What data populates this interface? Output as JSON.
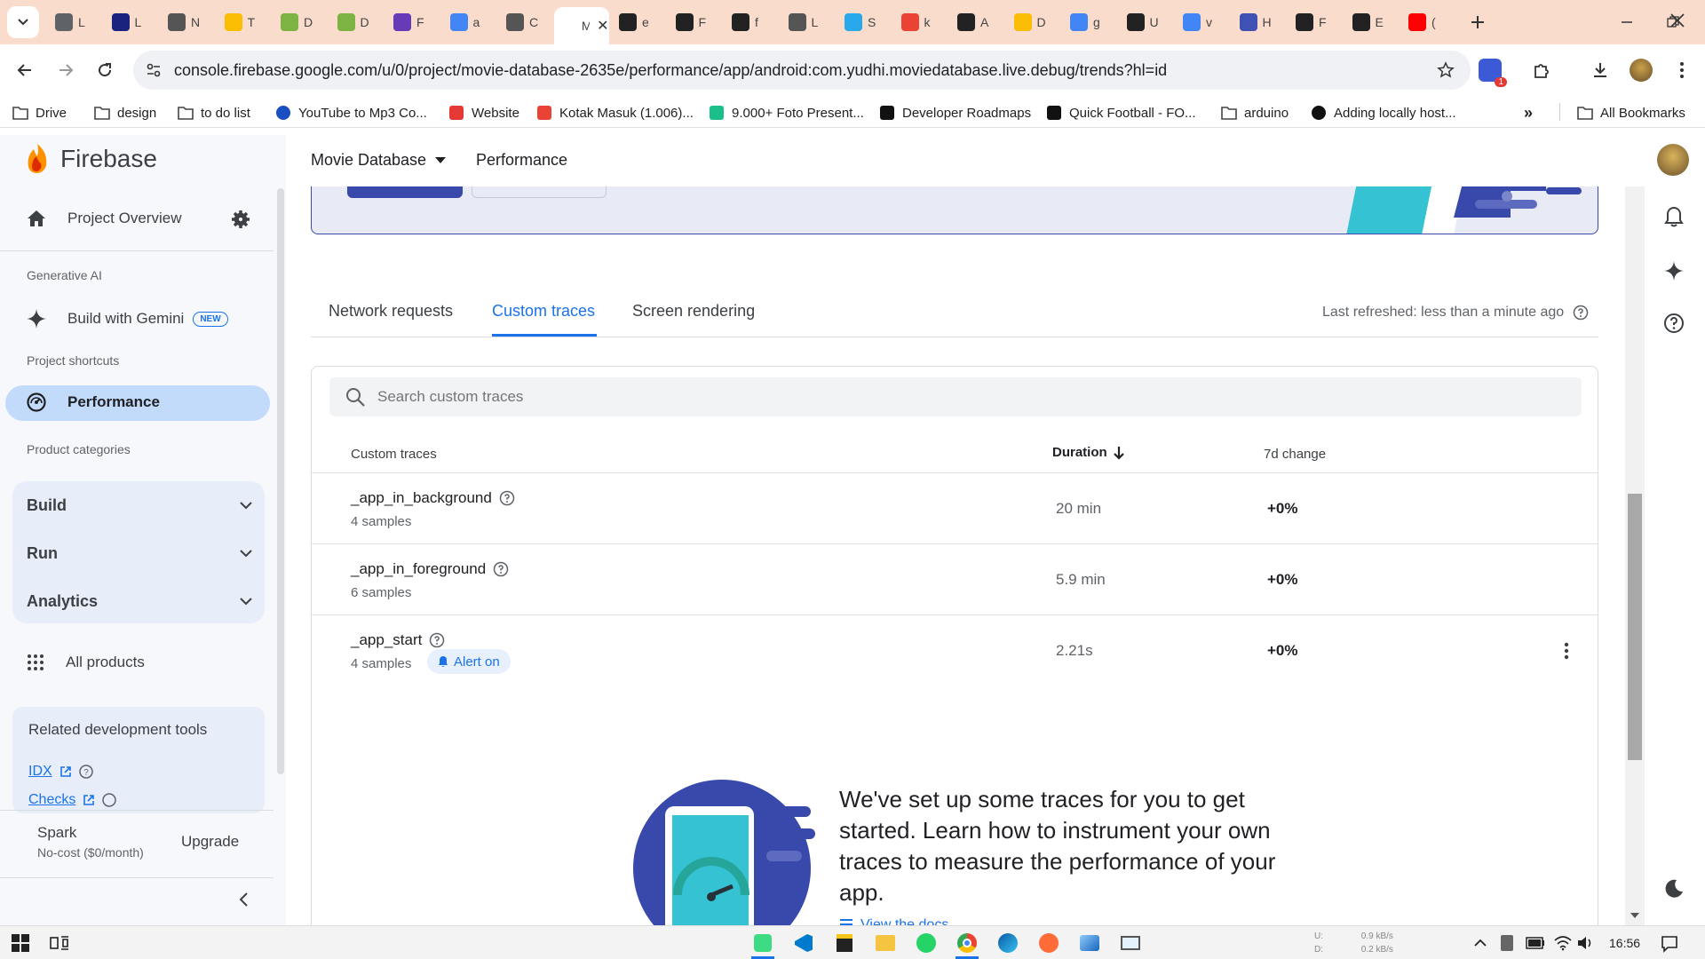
{
  "browser": {
    "tabs": [
      {
        "title": "L",
        "color": "#5f6368"
      },
      {
        "title": "L",
        "color": "#1a237e"
      },
      {
        "title": "N",
        "color": "#555"
      },
      {
        "title": "T",
        "color": "#fbbc04"
      },
      {
        "title": "D",
        "color": "#7cb342"
      },
      {
        "title": "D",
        "color": "#7cb342"
      },
      {
        "title": "F",
        "color": "#673ab7"
      },
      {
        "title": "a",
        "color": "#4285f4"
      },
      {
        "title": "C",
        "color": "#555"
      },
      {
        "title": "M",
        "color": "#fff"
      },
      {
        "title": "e",
        "color": "#222"
      },
      {
        "title": "F",
        "color": "#222"
      },
      {
        "title": "f",
        "color": "#222"
      },
      {
        "title": "L",
        "color": "#555"
      },
      {
        "title": "S",
        "color": "#29a9eb"
      },
      {
        "title": "k",
        "color": "#ea4335"
      },
      {
        "title": "A",
        "color": "#222"
      },
      {
        "title": "D",
        "color": "#fbbc04"
      },
      {
        "title": "g",
        "color": "#4285f4"
      },
      {
        "title": "U",
        "color": "#222"
      },
      {
        "title": "v",
        "color": "#4285f4"
      },
      {
        "title": "H",
        "color": "#3f51b5"
      },
      {
        "title": "F",
        "color": "#222"
      },
      {
        "title": "E",
        "color": "#222"
      },
      {
        "title": "(",
        "color": "#ff0000"
      }
    ],
    "url": "console.firebase.google.com/u/0/project/movie-database-2635e/performance/app/android:com.yudhi.moviedatabase.live.debug/trends?hl=id",
    "extension_badge": "1",
    "bookmarks": [
      {
        "label": "Drive",
        "icon": "folder-icon"
      },
      {
        "label": "design",
        "icon": "folder-icon"
      },
      {
        "label": "to do list",
        "icon": "folder-icon"
      },
      {
        "label": "YouTube to Mp3 Co...",
        "icon": "youtube-mp3-icon"
      },
      {
        "label": "Website",
        "icon": "website-icon"
      },
      {
        "label": "Kotak Masuk (1.006)...",
        "icon": "gmail-icon"
      },
      {
        "label": "9.000+ Foto Present...",
        "icon": "freepik-icon"
      },
      {
        "label": "Developer Roadmaps",
        "icon": "roadmap-icon"
      },
      {
        "label": "Quick Football - FO...",
        "icon": "quick-football-icon"
      },
      {
        "label": "arduino",
        "icon": "folder-icon"
      },
      {
        "label": "Adding locally host...",
        "icon": "github-icon"
      }
    ],
    "all_bookmarks": "All Bookmarks"
  },
  "firebase": {
    "brand": "Firebase",
    "project_name": "Movie Database",
    "section": "Performance",
    "sidebar": {
      "project_overview": "Project Overview",
      "generative_ai_label": "Generative AI",
      "build_with_gemini": "Build with Gemini",
      "new_badge": "NEW",
      "project_shortcuts_label": "Project shortcuts",
      "performance": "Performance",
      "product_categories_label": "Product categories",
      "categories": [
        "Build",
        "Run",
        "Analytics"
      ],
      "all_products": "All products",
      "related_tools_title": "Related development tools",
      "idx": "IDX",
      "checks": "Checks",
      "plan_name": "Spark",
      "plan_desc": "No-cost ($0/month)",
      "upgrade": "Upgrade"
    },
    "tabs": [
      "Network requests",
      "Custom traces",
      "Screen rendering"
    ],
    "active_tab": "Custom traces",
    "last_refreshed": "Last refreshed: less than a minute ago",
    "search_placeholder": "Search custom traces",
    "table": {
      "headers": {
        "name": "Custom traces",
        "duration": "Duration",
        "change": "7d change"
      },
      "rows": [
        {
          "name": "_app_in_background",
          "samples": "4 samples",
          "duration": "20 min",
          "change": "+0%"
        },
        {
          "name": "_app_in_foreground",
          "samples": "6 samples",
          "duration": "5.9 min",
          "change": "+0%"
        },
        {
          "name": "_app_start",
          "samples": "4 samples",
          "duration": "2.21s",
          "change": "+0%",
          "alert": "Alert on"
        }
      ]
    },
    "promo_text": "We've set up some traces for you to get started. Learn how to instrument your own traces to measure the performance of your app.",
    "promo_link": "View the docs"
  },
  "taskbar": {
    "clock": "16:56",
    "net_up": "0.9 kB/s",
    "net_down": "0.2 kB/s",
    "net_up_label": "U:",
    "net_down_label": "D:"
  },
  "colors": {
    "tabstrip": "#f9dccc",
    "accent": "#1a73e8",
    "active_nav": "#c2dbfb",
    "banner": "#e8eaf6",
    "brand_dark": "#3949ab",
    "teal": "#35c3d3"
  }
}
